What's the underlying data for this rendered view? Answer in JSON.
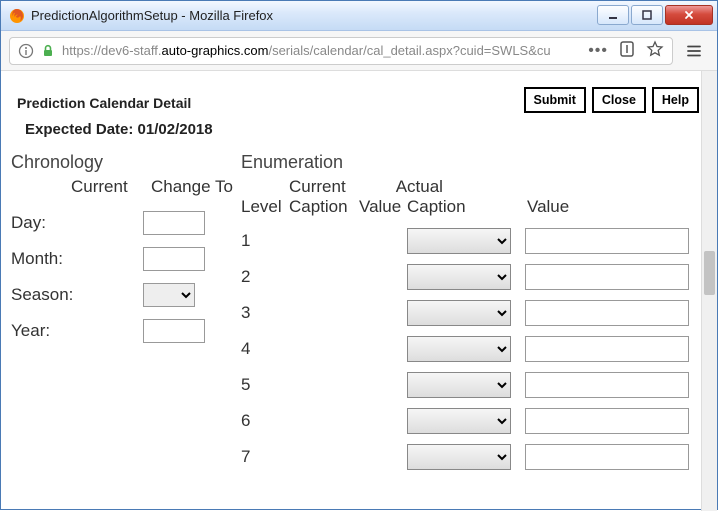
{
  "window": {
    "title": "PredictionAlgorithmSetup - Mozilla Firefox"
  },
  "url": {
    "scheme": "https://",
    "host_pre": "dev6-staff.",
    "host_bold": "auto-graphics.com",
    "path": "/serials/calendar/cal_detail.aspx?cuid=SWLS&cu"
  },
  "actions": {
    "submit": "Submit",
    "close": "Close",
    "help": "Help"
  },
  "page": {
    "title": "Prediction Calendar Detail",
    "expected_label": "Expected Date:",
    "expected_value": "01/02/2018"
  },
  "chronology": {
    "heading": "Chronology",
    "col_current": "Current",
    "col_changeto": "Change To",
    "rows": [
      {
        "label": "Day:",
        "current": "",
        "value": ""
      },
      {
        "label": "Month:",
        "current": "",
        "value": ""
      },
      {
        "label": "Season:",
        "current": "",
        "value": ""
      },
      {
        "label": "Year:",
        "current": "",
        "value": ""
      }
    ]
  },
  "enumeration": {
    "heading": "Enumeration",
    "group_current": "Current",
    "group_actual": "Actual",
    "col_level": "Level",
    "col_caption": "Caption",
    "col_value": "Value",
    "rows": [
      {
        "level": "1",
        "caption": "",
        "value": "",
        "actual_caption": "",
        "actual_value": ""
      },
      {
        "level": "2",
        "caption": "",
        "value": "",
        "actual_caption": "",
        "actual_value": ""
      },
      {
        "level": "3",
        "caption": "",
        "value": "",
        "actual_caption": "",
        "actual_value": ""
      },
      {
        "level": "4",
        "caption": "",
        "value": "",
        "actual_caption": "",
        "actual_value": ""
      },
      {
        "level": "5",
        "caption": "",
        "value": "",
        "actual_caption": "",
        "actual_value": ""
      },
      {
        "level": "6",
        "caption": "",
        "value": "",
        "actual_caption": "",
        "actual_value": ""
      },
      {
        "level": "7",
        "caption": "",
        "value": "",
        "actual_caption": "",
        "actual_value": ""
      }
    ]
  }
}
